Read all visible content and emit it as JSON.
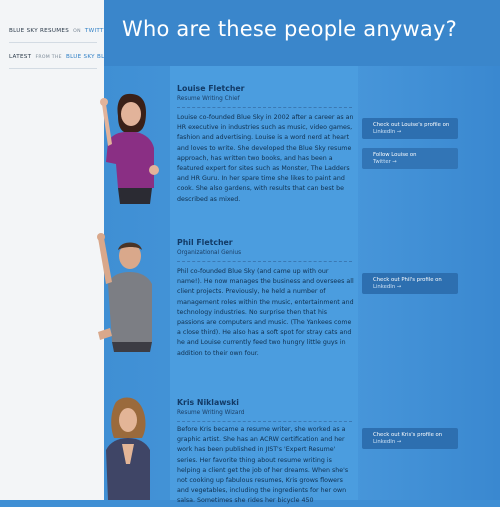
{
  "sidebar": {
    "link1": {
      "a": "Blue Sky Resumes",
      "b": "on",
      "c": "Twitter"
    },
    "link2": {
      "a": "Latest",
      "b": "from the",
      "c": "Blue Sky Blog"
    }
  },
  "header": {
    "title": "Who are these people anyway?"
  },
  "people": [
    {
      "name": "Louise Fletcher",
      "role": "Resume Writing Chief",
      "bio": "Louise co-founded Blue Sky in 2002 after a career as an HR executive in industries such as music, video games, fashion and advertising. Louise is a word nerd at heart and loves to write. She developed the Blue Sky resume approach, has written two books, and has been a featured expert for sites such as Monster, The Ladders and HR Guru. In her spare time she likes to paint and cook. She also gardens, with results that can best be described as mixed.",
      "buttons": [
        {
          "title": "Check out Louise's profile on",
          "sub": "LinkedIn →"
        },
        {
          "title": "Follow Louise on",
          "sub": "Twitter →"
        }
      ]
    },
    {
      "name": "Phil Fletcher",
      "role": "Organizational Genius",
      "bio": "Phil co-founded Blue Sky (and came up with our name!). He now manages the business and oversees all client projects. Previously, he held a number of management roles within the music, entertainment and technology industries. No surprise then that his passions are computers and music. (The Yankees come a close third). He also has a soft spot for stray cats and he and Louise currently feed two hungry little guys in addition to their own four.",
      "buttons": [
        {
          "title": "Check out Phil's profile on",
          "sub": "LinkedIn →"
        }
      ]
    },
    {
      "name": "Kris Niklawski",
      "role": "Resume Writing Wizard",
      "bio": "Before Kris became a resume writer, she worked as a graphic artist. She has an ACRW certification and her work has been published in JIST's 'Expert Resume' series. Her favorite thing about resume writing is helping a client get the job of her dreams. When she's not cooking up fabulous resumes, Kris grows flowers and vegetables, including the ingredients for her own salsa. Sometimes she rides her bicycle 450",
      "buttons": [
        {
          "title": "Check out Kris's profile on",
          "sub": "LinkedIn →"
        }
      ]
    }
  ],
  "colors": {
    "accent": "#3a86cb",
    "button": "#2d6fb0",
    "name": "#123a66"
  }
}
